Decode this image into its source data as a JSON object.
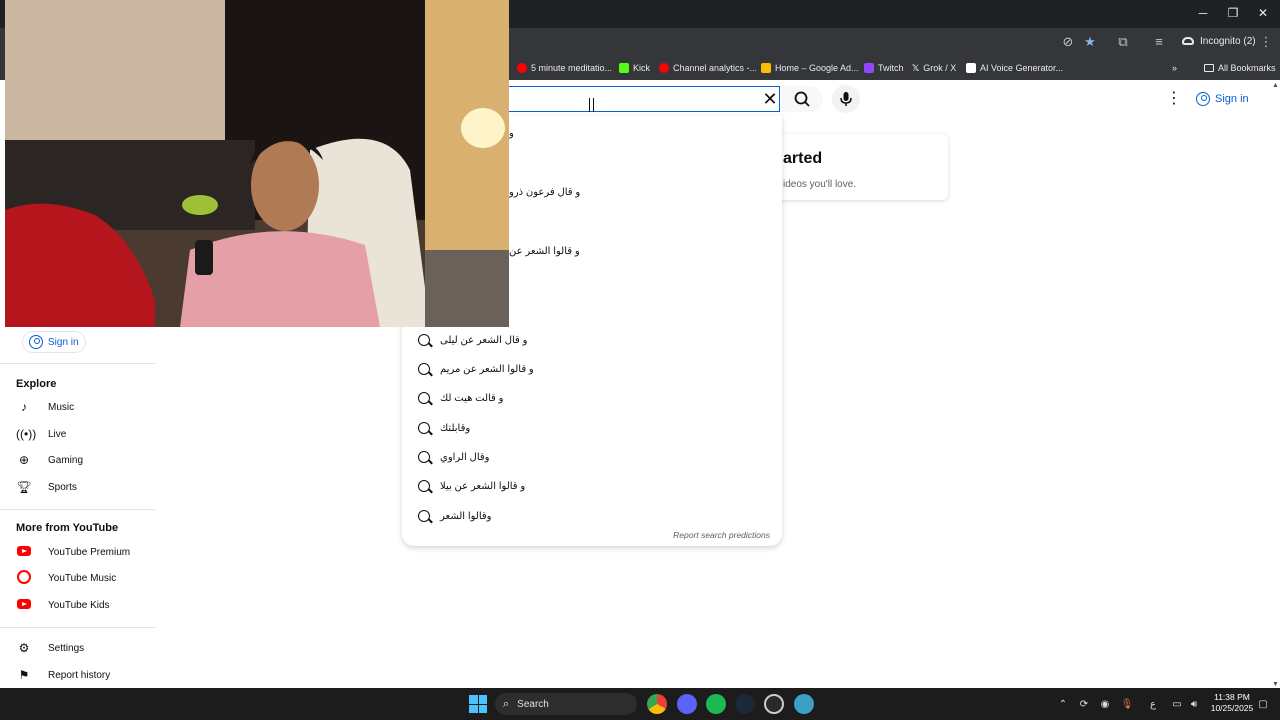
{
  "browser": {
    "window_buttons": {
      "minimize": "─",
      "restore": "❐",
      "close": "✕"
    },
    "incognito_label": "Incognito (2)",
    "bookmarks": [
      {
        "label": "5 minute meditatio...",
        "color": "#ff0000"
      },
      {
        "label": "Kick",
        "color": "#53fc18"
      },
      {
        "label": "Channel analytics -...",
        "color": "#ff0000"
      },
      {
        "label": "Home – Google Ad...",
        "color": "#fbbc04"
      },
      {
        "label": "Twitch",
        "color": "#9146ff"
      },
      {
        "label": "Grok / X",
        "color": "#ffffff"
      },
      {
        "label": "AI Voice Generator...",
        "color": "#ffffff"
      }
    ],
    "all_bookmarks": "All Bookmarks"
  },
  "youtube": {
    "sign_in": "Sign in",
    "card_title": "arted",
    "card_subtitle": "ideos you'll love.",
    "suggestions_partial": [
      "و",
      "و قال فرعون ذرو",
      "و قالوا الشعر عن"
    ],
    "suggestions": [
      "و قال الشعر عن ليلى",
      "و قالوا الشعر عن مريم",
      "و قالت هيت لك",
      "وقابلتك",
      "وقال الراوي",
      "و قالوا الشعر عن بيلا",
      "وقالوا الشعر"
    ],
    "report_predictions": "Report search predictions",
    "sidebar": {
      "sign_in": "Sign in",
      "explore_title": "Explore",
      "explore": [
        {
          "label": "Music",
          "icon": "music-note-icon"
        },
        {
          "label": "Live",
          "icon": "live-icon"
        },
        {
          "label": "Gaming",
          "icon": "gaming-icon"
        },
        {
          "label": "Sports",
          "icon": "trophy-icon"
        }
      ],
      "more_title": "More from YouTube",
      "more": [
        {
          "label": "YouTube Premium",
          "icon": "youtube-premium-icon"
        },
        {
          "label": "YouTube Music",
          "icon": "youtube-music-icon"
        },
        {
          "label": "YouTube Kids",
          "icon": "youtube-kids-icon"
        }
      ],
      "settings": "Settings",
      "report_history": "Report history"
    }
  },
  "taskbar": {
    "search_label": "Search",
    "time": "11:38 PM",
    "date": "10/25/2025",
    "lang": "ع"
  }
}
